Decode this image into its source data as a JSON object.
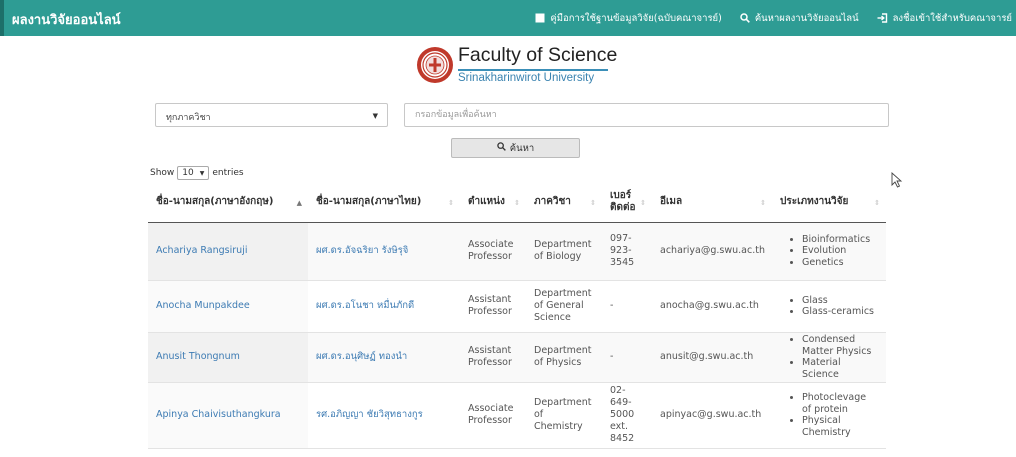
{
  "navbar": {
    "brand": "ผลงานวิจัยออนไลน์",
    "links": [
      {
        "icon": "book-icon",
        "label": "คู่มือการใช้ฐานข้อมูลวิจัย(ฉบับคณาจารย์)"
      },
      {
        "icon": "search-icon",
        "label": "ค้นหาผลงานวิจัยออนไลน์"
      },
      {
        "icon": "login-icon",
        "label": "ลงชื่อเข้าใช้สำหรับคณาจารย์"
      }
    ]
  },
  "logo": {
    "title": "Faculty of Science",
    "subtitle": "Srinakharinwirot University"
  },
  "filters": {
    "department_selected": "ทุกภาควิชา",
    "search_placeholder": "กรอกข้อมูลเพื่อค้นหา",
    "search_button": "ค้นหา"
  },
  "length": {
    "show": "Show",
    "value": "10",
    "entries": "entries"
  },
  "table": {
    "headers": [
      "ชื่อ-นามสกุล(ภาษาอังกฤษ)",
      "ชื่อ-นามสกุล(ภาษาไทย)",
      "ตำแหน่ง",
      "ภาควิชา",
      "เบอร์ติดต่อ",
      "อีเมล",
      "ประเภทงานวิจัย"
    ],
    "rows": [
      {
        "name_en": "Achariya Rangsiruji",
        "name_th": "ผศ.ดร.อัจฉริยา รังษิรุจิ",
        "position": "Associate Professor",
        "department": "Department of Biology",
        "phone": "097-923-3545",
        "email": "achariya@g.swu.ac.th",
        "research": [
          "Bioinformatics",
          "Evolution",
          "Genetics"
        ]
      },
      {
        "name_en": "Anocha Munpakdee",
        "name_th": "ผศ.ดร.อโนชา หมื่นภักดี",
        "position": "Assistant Professor",
        "department": "Department of General Science",
        "phone": "-",
        "email": "anocha@g.swu.ac.th",
        "research": [
          "Glass",
          "Glass-ceramics"
        ]
      },
      {
        "name_en": "Anusit Thongnum",
        "name_th": "ผศ.ดร.อนุศิษฏ์ ทองนำ",
        "position": "Assistant Professor",
        "department": "Department of Physics",
        "phone": "-",
        "email": "anusit@g.swu.ac.th",
        "research": [
          "Condensed Matter Physics",
          "Material Science"
        ]
      },
      {
        "name_en": "Apinya Chaivisuthangkura",
        "name_th": "รศ.อภิญญา ชัยวิสุทธางกูร",
        "position": "Associate Professor",
        "department": "Department of Chemistry",
        "phone": "02-649-5000 ext. 8452",
        "email": "apinyac@g.swu.ac.th",
        "research": [
          "Photoclevage of protein",
          "Physical Chemistry"
        ]
      }
    ]
  },
  "colors": {
    "navbar": "#2e9c94",
    "link": "#3d7bb3"
  }
}
